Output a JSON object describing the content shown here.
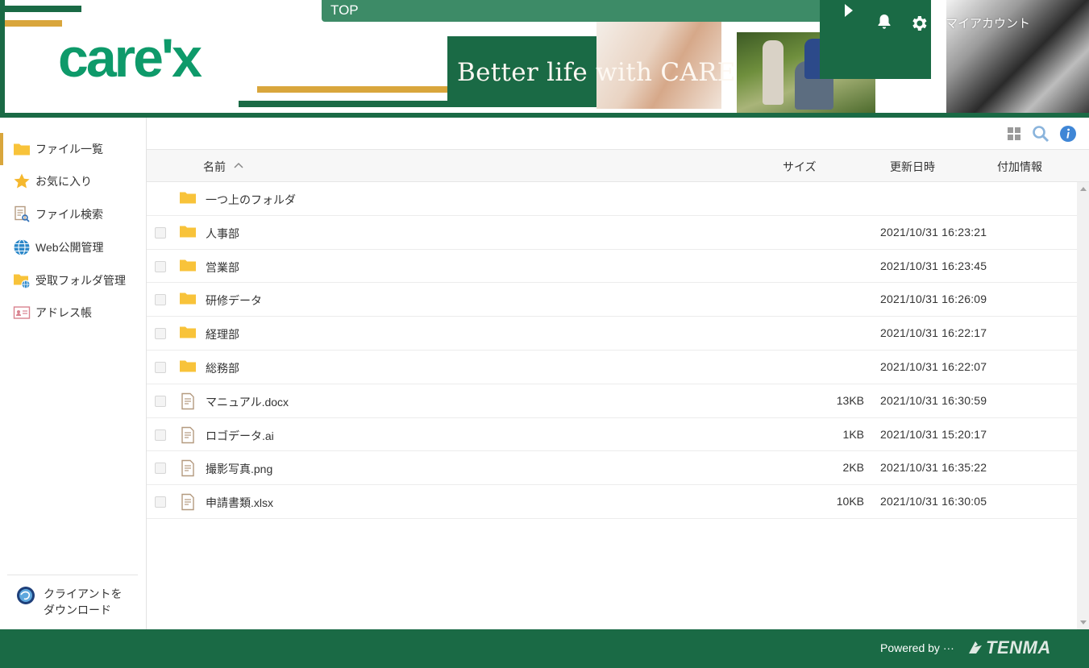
{
  "header": {
    "logo_text": "care'x",
    "top_label": "TOP",
    "slogan": "Better life with CARE",
    "account_label": "マイアカウント",
    "icons": [
      "play-icon",
      "bell-icon",
      "gear-icon"
    ]
  },
  "sidebar": {
    "items": [
      {
        "label": "ファイル一覧",
        "icon": "folder-icon",
        "active": true
      },
      {
        "label": "お気に入り",
        "icon": "star-icon",
        "active": false
      },
      {
        "label": "ファイル検索",
        "icon": "file-search-icon",
        "active": false
      },
      {
        "label": "Web公開管理",
        "icon": "globe-icon",
        "active": false
      },
      {
        "label": "受取フォルダ管理",
        "icon": "receive-folder-icon",
        "active": false
      },
      {
        "label": "アドレス帳",
        "icon": "address-book-icon",
        "active": false
      }
    ],
    "client_download": "クライアントを\nダウンロード"
  },
  "toolbar": {
    "icons": [
      "grid-view-icon",
      "search-icon",
      "info-icon"
    ]
  },
  "table": {
    "columns": {
      "name": "名前",
      "size": "サイズ",
      "modified": "更新日時",
      "extra": "付加情報"
    },
    "sort": {
      "column": "name",
      "direction": "ascending"
    },
    "parent_folder_label": "一つ上のフォルダ",
    "rows": [
      {
        "type": "folder",
        "name": "人事部",
        "size": "",
        "modified": "2021/10/31 16:23:21"
      },
      {
        "type": "folder",
        "name": "営業部",
        "size": "",
        "modified": "2021/10/31 16:23:45"
      },
      {
        "type": "folder",
        "name": "研修データ",
        "size": "",
        "modified": "2021/10/31 16:26:09"
      },
      {
        "type": "folder",
        "name": "経理部",
        "size": "",
        "modified": "2021/10/31 16:22:17"
      },
      {
        "type": "folder",
        "name": "総務部",
        "size": "",
        "modified": "2021/10/31 16:22:07"
      },
      {
        "type": "file",
        "name": "マニュアル.docx",
        "size": "13KB",
        "modified": "2021/10/31 16:30:59"
      },
      {
        "type": "file",
        "name": "ロゴデータ.ai",
        "size": "1KB",
        "modified": "2021/10/31 15:20:17"
      },
      {
        "type": "file",
        "name": "撮影写真.png",
        "size": "2KB",
        "modified": "2021/10/31 16:35:22"
      },
      {
        "type": "file",
        "name": "申請書類.xlsx",
        "size": "10KB",
        "modified": "2021/10/31 16:30:05"
      }
    ]
  },
  "footer": {
    "powered_by": "Powered by ···",
    "brand": "TENMA"
  },
  "colors": {
    "brand_green": "#1a6a45",
    "accent_gold": "#d9a63c",
    "logo_green": "#0e9a6a",
    "folder_yellow": "#f8c33a"
  }
}
